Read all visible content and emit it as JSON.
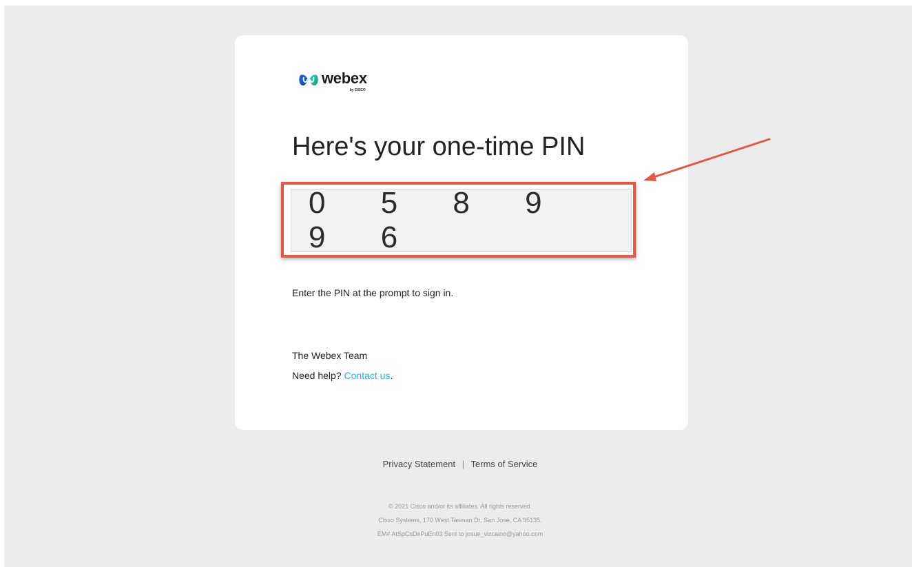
{
  "brand": {
    "name": "webex",
    "sub": "by CISCO",
    "logo_icon": "webex-logo-icon",
    "accent_color": "#15b8e6",
    "highlight_color": "#e05a48"
  },
  "email": {
    "heading": "Here's your one-time PIN",
    "pin": "0 5 8 9 9 6",
    "instruction": "Enter the PIN at the prompt to sign in.",
    "signoff": "The Webex Team",
    "help_prefix": "Need help? ",
    "help_link": "Contact us",
    "help_suffix": "."
  },
  "footer": {
    "privacy": "Privacy Statement",
    "separator": "|",
    "terms": "Terms of Service",
    "legal": [
      "© 2021 Cisco and/or its affiliates. All rights reserved.",
      "Cisco Systems, 170 West Tasman Dr, San Jose, CA 95135.",
      "EM# AtSpCsDePuEn03 Sent to josue_vizcaino@yahoo.com"
    ]
  }
}
